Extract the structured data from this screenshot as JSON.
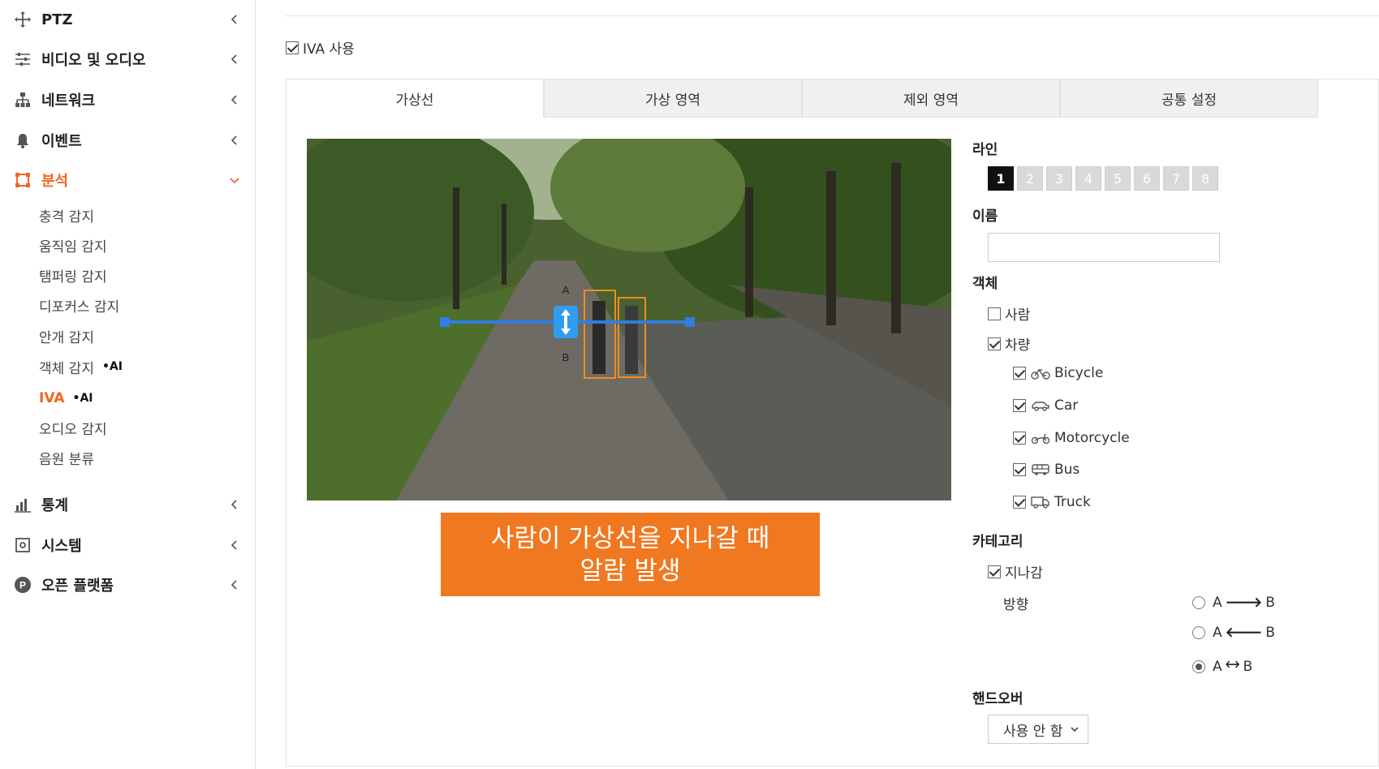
{
  "sidebar": {
    "items": [
      {
        "label": "PTZ",
        "icon": "move-icon"
      },
      {
        "label": "비디오 및 오디오",
        "icon": "sliders-icon"
      },
      {
        "label": "네트워크",
        "icon": "network-icon"
      },
      {
        "label": "이벤트",
        "icon": "bell-icon"
      },
      {
        "label": "분석",
        "icon": "analysis-icon"
      },
      {
        "label": "통계",
        "icon": "bar-chart-icon"
      },
      {
        "label": "시스템",
        "icon": "system-icon"
      },
      {
        "label": "오픈 플랫폼",
        "icon": "platform-p-icon"
      }
    ],
    "sub_items": [
      {
        "label": "충격 감지"
      },
      {
        "label": "움직임 감지"
      },
      {
        "label": "탬퍼링 감지"
      },
      {
        "label": "디포커스 감지"
      },
      {
        "label": "안개 감지"
      },
      {
        "label": "객체 감지",
        "tag": "•AI"
      },
      {
        "label": "IVA",
        "tag": "•AI"
      },
      {
        "label": "오디오 감지"
      },
      {
        "label": "음원 분류"
      }
    ],
    "active_color": "#f26522"
  },
  "main": {
    "iva_enable_label": "IVA 사용",
    "iva_enabled": true,
    "tabs": [
      {
        "label": "가상선"
      },
      {
        "label": "가상 영역"
      },
      {
        "label": "제외 영역"
      },
      {
        "label": "공통 설정"
      }
    ],
    "video": {
      "marker_a": "A",
      "marker_b": "B"
    },
    "caption": {
      "line1": "사람이 가상선을 지나갈 때",
      "line2": "알람 발생",
      "color": "#f07820"
    },
    "settings": {
      "line_title": "라인",
      "line_buttons": [
        "1",
        "2",
        "3",
        "4",
        "5",
        "6",
        "7",
        "8"
      ],
      "line_selected": "1",
      "name_title": "이름",
      "name_value": "",
      "object_title": "객체",
      "person_label": "사람",
      "vehicle_label": "차량",
      "vehicles": [
        {
          "label": "Bicycle",
          "icon": "bicycle-icon"
        },
        {
          "label": "Car",
          "icon": "car-icon"
        },
        {
          "label": "Motorcycle",
          "icon": "motorcycle-icon"
        },
        {
          "label": "Bus",
          "icon": "bus-icon"
        },
        {
          "label": "Truck",
          "icon": "truck-icon"
        }
      ],
      "category_title": "카테고리",
      "pass_label": "지나감",
      "direction_label": "방향",
      "directions": [
        {
          "a": "A",
          "arrow": "🡒",
          "b": "B"
        },
        {
          "a": "A",
          "arrow": "🡐",
          "b": "B"
        },
        {
          "a": "A",
          "arrow": "🡘",
          "b": "B"
        }
      ],
      "direction_selected_index": 2,
      "handover_title": "핸드오버",
      "handover_value": "사용 안 함"
    }
  }
}
